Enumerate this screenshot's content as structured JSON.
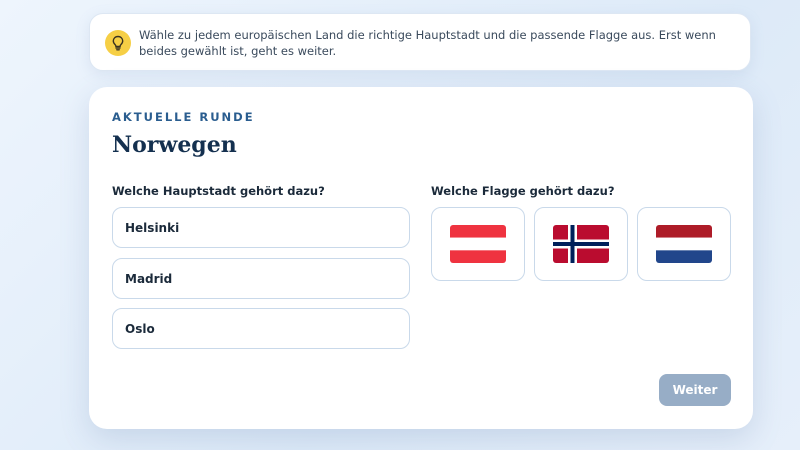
{
  "hint": {
    "icon": "lightbulb-icon",
    "text": "Wähle zu jedem europäischen Land die richtige Hauptstadt und die passende Flagge aus. Erst wenn beides gewählt ist, geht es weiter."
  },
  "round": {
    "eyebrow": "AKTUELLE RUNDE",
    "country": "Norwegen"
  },
  "capital_question": {
    "label": "Welche Hauptstadt gehört dazu?",
    "options": [
      "Helsinki",
      "Madrid",
      "Oslo"
    ]
  },
  "flag_question": {
    "label": "Welche Flagge gehört dazu?",
    "options": [
      {
        "icon": "austria-flag-icon",
        "colors": [
          "#ef3340",
          "#ffffff",
          "#ef3340"
        ]
      },
      {
        "icon": "norway-flag-icon",
        "colors": [
          "#ba0c2f",
          "#ffffff",
          "#00205b"
        ]
      },
      {
        "icon": "netherlands-flag-icon",
        "colors": [
          "#ae1c28",
          "#ffffff",
          "#21468b"
        ]
      }
    ]
  },
  "actions": {
    "next_label": "Weiter"
  },
  "colors": {
    "accent": "#2a5d8f",
    "title": "#14304f",
    "hint_icon_bg": "#f6cf45",
    "next_button_bg": "#97adc6"
  }
}
